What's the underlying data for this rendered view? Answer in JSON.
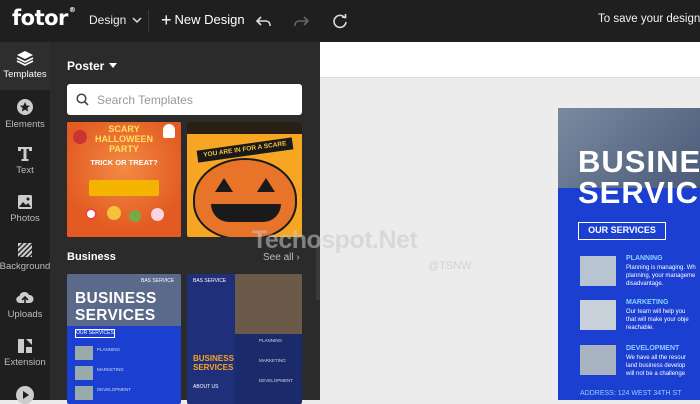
{
  "topbar": {
    "logo": "fotor",
    "logo_mark": "®",
    "design_label": "Design",
    "new_design_label": "New Design",
    "save_message": "To save your design,"
  },
  "rail": [
    {
      "label": "Templates",
      "icon": "layers-icon"
    },
    {
      "label": "Elements",
      "icon": "star-circle-icon"
    },
    {
      "label": "Text",
      "icon": "text-icon"
    },
    {
      "label": "Photos",
      "icon": "photo-icon"
    },
    {
      "label": "Background",
      "icon": "background-icon"
    },
    {
      "label": "Uploads",
      "icon": "upload-icon"
    },
    {
      "label": "Extension",
      "icon": "extension-icon"
    }
  ],
  "panel": {
    "category": "Poster",
    "search_placeholder": "Search Templates",
    "section_title": "Business",
    "see_all": "See all",
    "halloween1": {
      "title1": "SCARY",
      "title2": "HALLOWEEN",
      "title3": "PARTY",
      "sub": "TRICK OR TREAT?"
    },
    "halloween2": {
      "banner": "YOU ARE IN FOR A SCARE"
    },
    "business1": {
      "badge": "BAS SERVICE",
      "title1": "BUSINESS",
      "title2": "SERVICES",
      "btn": "OUR SERVICES",
      "items": [
        "PLANNING",
        "MARKETING",
        "DEVELOPMENT"
      ]
    },
    "business2": {
      "badge": "BAS SERVICE",
      "title1": "BUSINESS",
      "title2": "SERVICES",
      "about": "ABOUT US",
      "items": [
        "PLANNING",
        "MARKETING",
        "DEVELOPMENT"
      ]
    }
  },
  "poster": {
    "title1": "BUSINES",
    "title2": "SERVICE",
    "btn": "OUR SERVICES",
    "items": [
      {
        "title": "PLANNING",
        "lines": [
          "Planning is managing. Wh",
          "planning, your manageme",
          "disadvantage."
        ]
      },
      {
        "title": "MARKETING",
        "lines": [
          "Our team will help you",
          "that will make your obje",
          "reachable."
        ]
      },
      {
        "title": "DEVELOPMENT",
        "lines": [
          "We have all the resour",
          "land business develop",
          "will not be a challenge"
        ]
      }
    ],
    "address": "ADDRESS: 124 WEST 34TH ST"
  },
  "watermark": {
    "text": "Techospot.Net",
    "handle": "@TSNW"
  },
  "colors": {
    "bg": "#1f1f1f",
    "panel": "#2b2b2b",
    "poster_blue": "#1b3fd0",
    "halloween_orange": "#e8692e"
  }
}
